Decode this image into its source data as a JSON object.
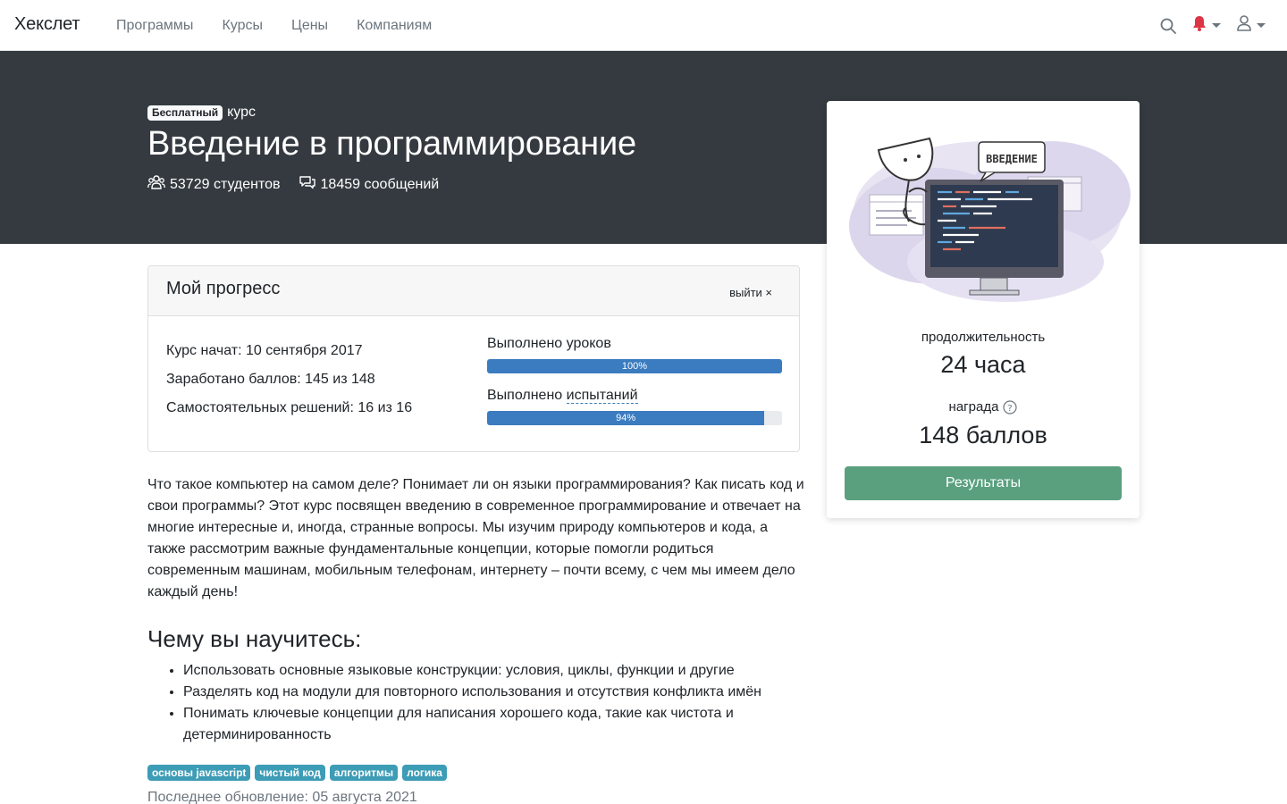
{
  "navbar": {
    "brand": "Хекслет",
    "links": [
      "Программы",
      "Курсы",
      "Цены",
      "Компаниям"
    ],
    "icons": [
      "search-icon",
      "bell-icon",
      "user-icon"
    ],
    "bell_color": "#dc3545"
  },
  "hero": {
    "badge": "Бесплатный",
    "kind": "курс",
    "title": "Введение в программирование",
    "students": "53729 студентов",
    "messages": "18459 сообщений"
  },
  "progress": {
    "title": "Мой прогресс",
    "leave": "выйти ×",
    "started": "Курс начат: 10 сентября 2017",
    "points": "Заработано баллов: 145 из 148",
    "solutions": "Самостоятельных решений: 16 из 16",
    "lessons_label": "Выполнено уроков",
    "lessons_percent": "100%",
    "lessons_value": 1.0,
    "tests_label_prefix": "Выполнено ",
    "tests_label_link": "испытаний",
    "tests_percent": "94%",
    "tests_value": 0.94
  },
  "description": "Что такое компьютер на самом деле? Понимает ли он языки программирования? Как писать код и свои программы? Этот курс посвящен введению в современное программирование и отвечает на многие интересные и, иногда, странные вопросы. Мы изучим природу компьютеров и кода, а также рассмотрим важные фундаментальные концепции, которые помогли родиться современным машинам, мобильным телефонам, интернету – почти всему, с чем мы имеем дело каждый день!",
  "learn": {
    "title": "Чему вы научитесь:",
    "items": [
      "Использовать основные языковые конструкции: условия, циклы, функции и другие",
      "Разделять код на модули для повторного использования и отсутствия конфликта имён",
      "Понимать ключевые концепции для написания хорошего кода, такие как чистота и детерминированность"
    ]
  },
  "tags": [
    "основы javascript",
    "чистый код",
    "алгоритмы",
    "логика"
  ],
  "updated": "Последнее обновление: 05 августа 2021",
  "side": {
    "illustration_text": "ВВЕДЕНИЕ",
    "duration_label": "продолжительность",
    "duration_value": "24 часа",
    "reward_label": "награда",
    "reward_value": "148 баллов",
    "results_button": "Результаты",
    "button_color": "#5aa07f"
  }
}
